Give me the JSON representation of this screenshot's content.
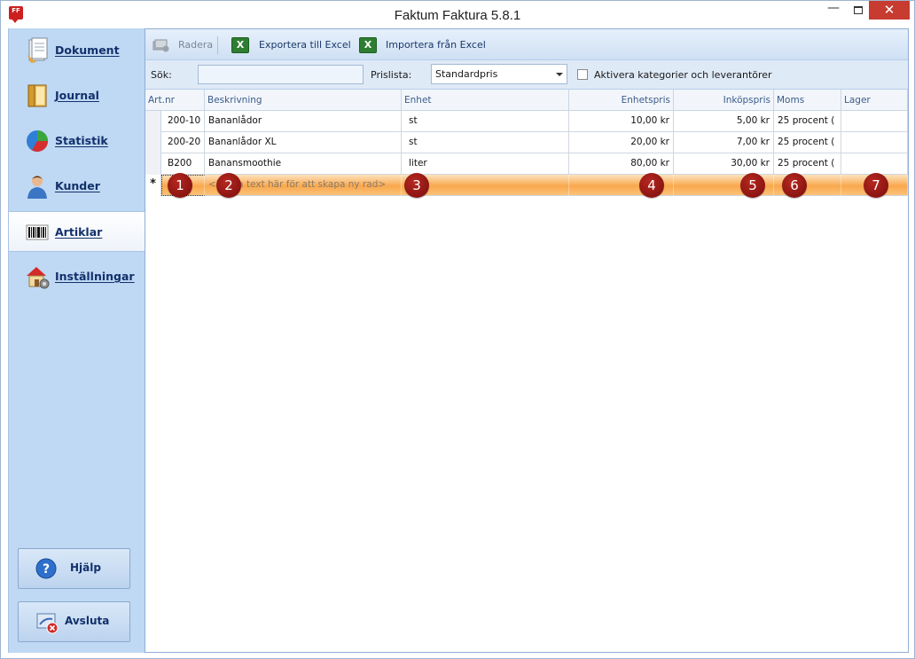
{
  "window": {
    "title": "Faktum Faktura 5.8.1",
    "app_icon_text": "FF",
    "minimize_glyph": "—",
    "close_glyph": "✕"
  },
  "sidebar": {
    "items": [
      {
        "label": "Dokument",
        "icon": "document-icon"
      },
      {
        "label": "Journal",
        "icon": "journal-icon"
      },
      {
        "label": "Statistik",
        "icon": "pie-chart-icon"
      },
      {
        "label": "Kunder",
        "icon": "customer-icon"
      },
      {
        "label": "Artiklar",
        "icon": "barcode-icon",
        "active": true
      },
      {
        "label": "Inställningar",
        "icon": "house-settings-icon"
      }
    ],
    "help_label": "Hjälp",
    "exit_label": "Avsluta"
  },
  "toolbar": {
    "delete_label": "Radera",
    "export_label": "Exportera till Excel",
    "import_label": "Importera från Excel"
  },
  "filter": {
    "search_label": "Sök:",
    "search_value": "",
    "pricelist_label": "Prislista:",
    "pricelist_value": "Standardpris",
    "activate_label": "Aktivera kategorier och leverantörer",
    "activate_checked": false
  },
  "grid": {
    "columns": [
      "Art.nr",
      "Beskrivning",
      "Enhet",
      "Enhetspris",
      "Inköpspris",
      "Moms",
      "Lager"
    ],
    "rows": [
      {
        "artnr": "200-10",
        "beskrivning": "Bananlådor",
        "enhet": "st",
        "enhetspris": "10,00 kr",
        "inkopspris": "5,00 kr",
        "moms": "25 procent (",
        "lager": ""
      },
      {
        "artnr": "200-20",
        "beskrivning": "Bananlådor XL",
        "enhet": "st",
        "enhetspris": "20,00 kr",
        "inkopspris": "7,00 kr",
        "moms": "25 procent (",
        "lager": ""
      },
      {
        "artnr": "B200",
        "beskrivning": "Banansmoothie",
        "enhet": "liter",
        "enhetspris": "80,00 kr",
        "inkopspris": "30,00 kr",
        "moms": "25 procent (",
        "lager": ""
      }
    ],
    "new_row_marker": "*",
    "new_row_placeholder": "<Klicka text här för att skapa ny rad>",
    "badges": [
      "1",
      "2",
      "3",
      "4",
      "5",
      "6",
      "7"
    ]
  },
  "colors": {
    "sidebar_bg": "#bfd8f3",
    "nav_text": "#12306b",
    "new_row_orange": "#f9a84c",
    "badge_red": "#9a1a14",
    "close_red": "#c73b30"
  }
}
